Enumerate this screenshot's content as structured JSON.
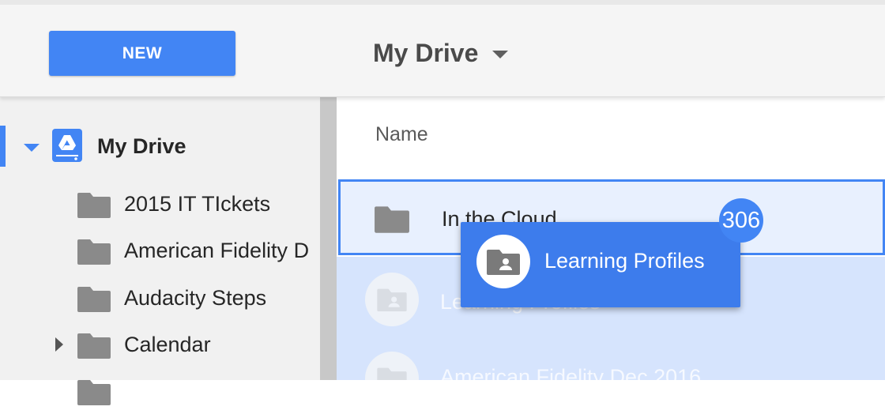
{
  "toolbar": {
    "new_label": "NEW"
  },
  "header": {
    "breadcrumb_title": "My Drive"
  },
  "sidebar": {
    "root_label": "My Drive",
    "folders": [
      {
        "label": "2015 IT TIckets"
      },
      {
        "label": "American Fidelity D"
      },
      {
        "label": "Audacity Steps"
      },
      {
        "label": "Calendar"
      }
    ]
  },
  "main": {
    "column_header": "Name",
    "rows": [
      {
        "label": "In the Cloud"
      },
      {
        "label": "Learning Profiles"
      },
      {
        "label": "American Fidelity Dec 2016"
      }
    ]
  },
  "drag": {
    "label": "Learning Profiles",
    "count": "306"
  },
  "icons": [
    "drive-icon",
    "folder-icon",
    "shared-folder-icon",
    "caret-down-icon",
    "expand-arrow-icon"
  ],
  "colors": {
    "accent": "#4285f4",
    "selection": "#e8f0fe",
    "folder": "#8a8a8a"
  }
}
